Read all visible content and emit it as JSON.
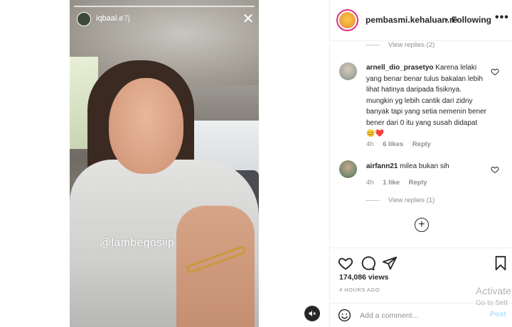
{
  "story": {
    "username": "iqbaal.e",
    "time": "7j",
    "watermark": "@lambegosiip"
  },
  "post": {
    "author": "pembasmi.kehaluan.re",
    "separator": "•",
    "follow_status": "Following",
    "more_label": "•••"
  },
  "comments": {
    "top_view_replies": "View replies (2)",
    "items": [
      {
        "username": "arnell_dio_prasetyo",
        "text": "Karena lelaki yang benar benar tulus bakalan lebih lihat hatinya daripada fisiknya. mungkin yg lebih cantik dari zidny banyak tapi yang setia nemenin bener bener dari 0 itu yang susah didapat 😊❤️",
        "time": "4h",
        "likes": "6 likes",
        "reply": "Reply"
      },
      {
        "username": "airfann21",
        "text": "milea bukan sih",
        "time": "4h",
        "likes": "1 like",
        "reply": "Reply",
        "view_replies": "View replies (1)"
      }
    ],
    "load_more": "+"
  },
  "actions": {
    "views": "174,086 views",
    "ago": "4 HOURS AGO"
  },
  "add_comment": {
    "placeholder": "Add a comment...",
    "post_label": "Post"
  },
  "overlay": {
    "activate": "Activate",
    "activate_sub": "Go to Sett"
  }
}
